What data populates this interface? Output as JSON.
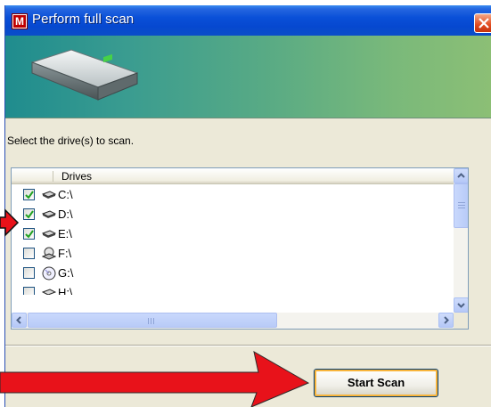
{
  "window": {
    "title": "Perform full scan",
    "app_icon_letter": "M"
  },
  "instruction": "Select the drive(s) to scan.",
  "list": {
    "column_header": "Drives",
    "items": [
      {
        "label": "C:\\",
        "checked": true,
        "icon": "hard-drive-icon"
      },
      {
        "label": "D:\\",
        "checked": true,
        "icon": "hard-drive-icon"
      },
      {
        "label": "E:\\",
        "checked": true,
        "icon": "hard-drive-icon"
      },
      {
        "label": "F:\\",
        "checked": false,
        "icon": "floppy-drive-icon"
      },
      {
        "label": "G:\\",
        "checked": false,
        "icon": "cd-drive-icon"
      },
      {
        "label": "H:\\",
        "checked": false,
        "icon": "hard-drive-icon"
      }
    ]
  },
  "buttons": {
    "start_scan": "Start Scan"
  },
  "colors": {
    "title_bar": "#0a50d8",
    "banner_start": "#1f8c8e",
    "banner_end": "#8cbf75",
    "annotation_arrow": "#e8121a",
    "check_mark": "#21a121"
  }
}
